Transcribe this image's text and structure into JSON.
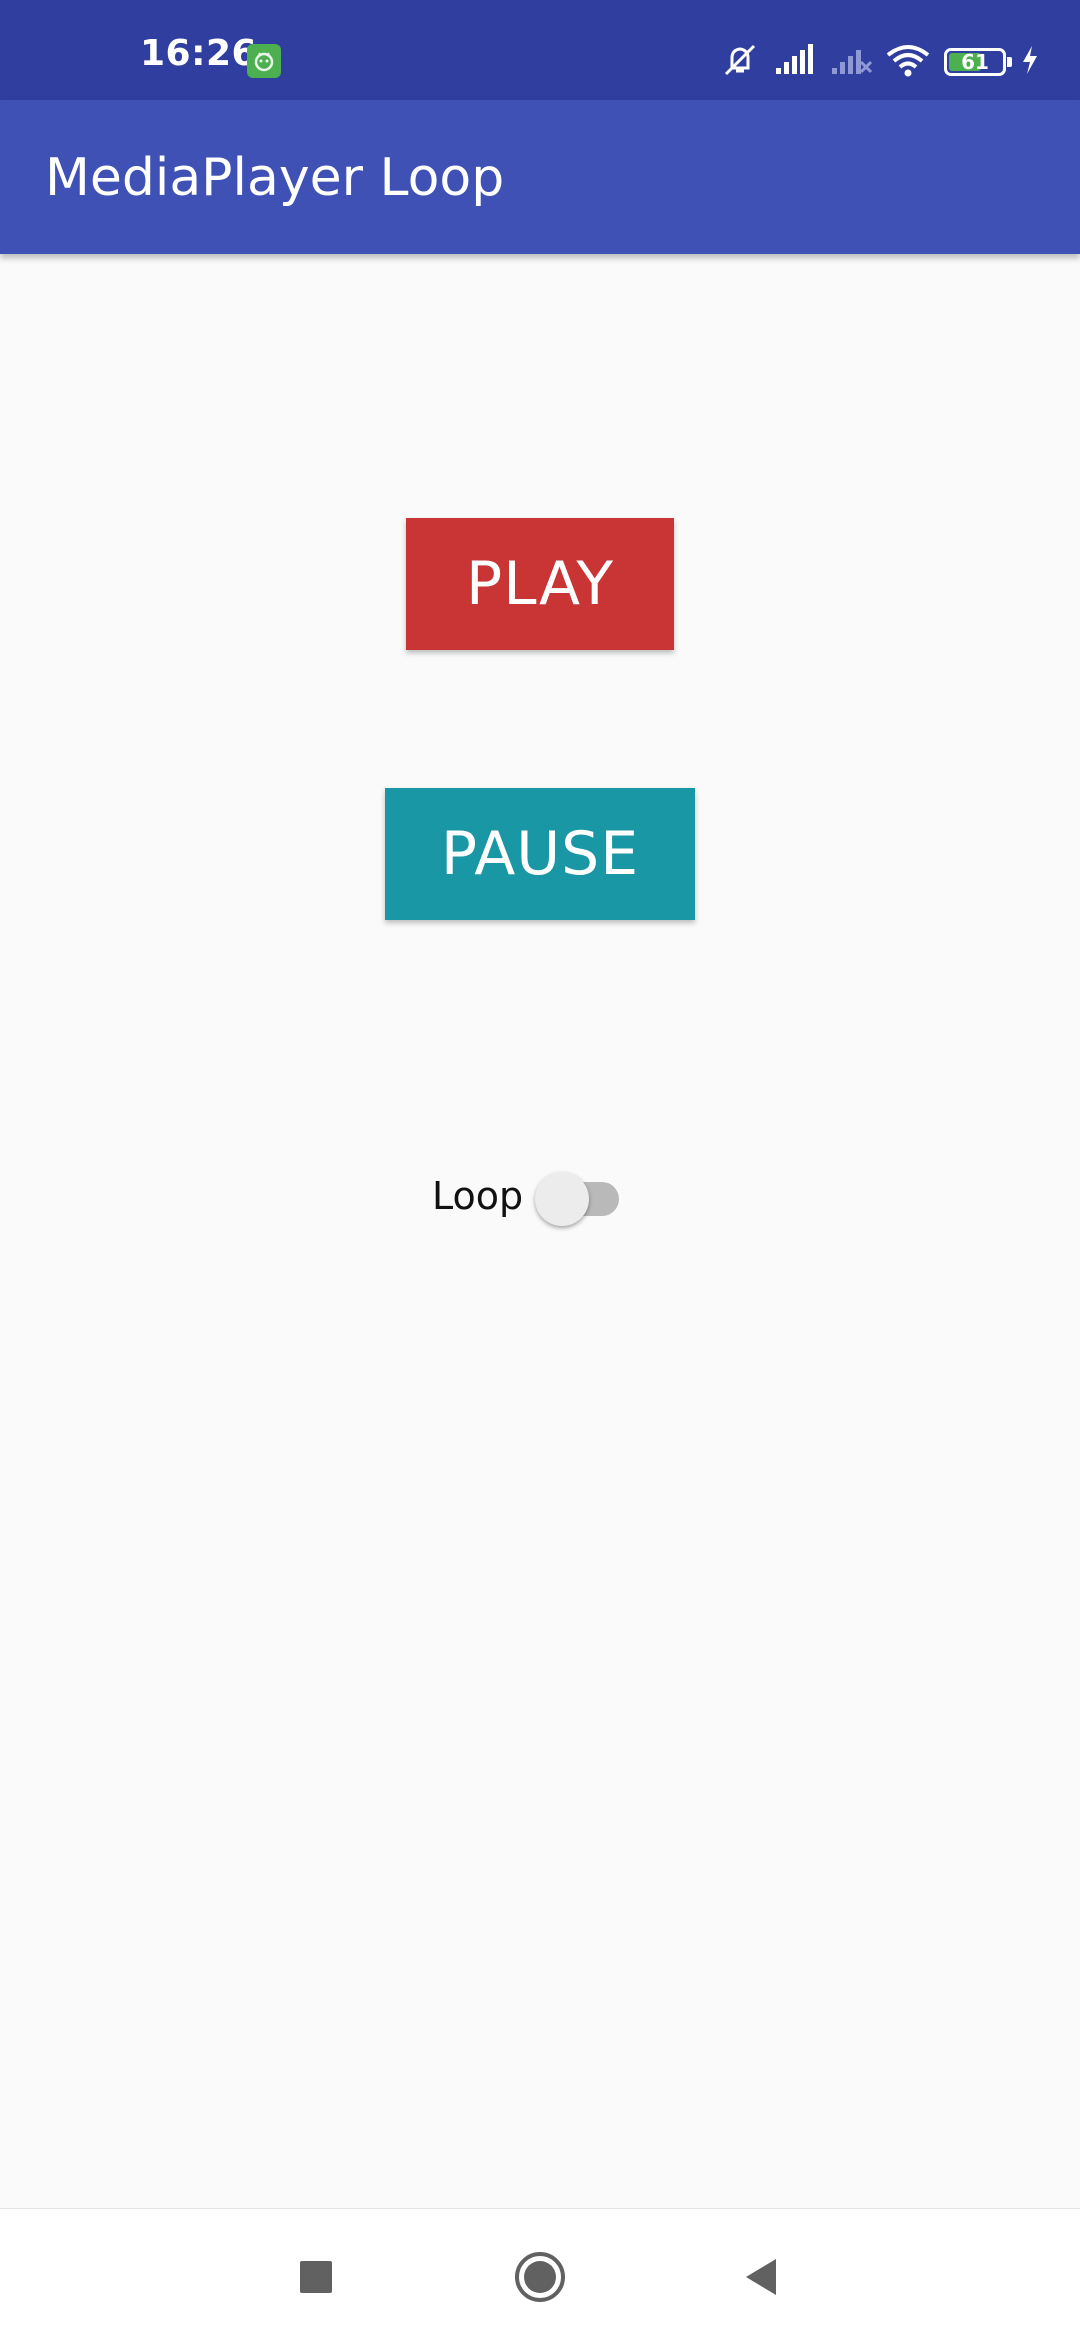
{
  "status_bar": {
    "time": "16:26",
    "battery_level": "61",
    "battery_fraction": 0.61,
    "icons": [
      "app-notification-icon",
      "mute-icon",
      "signal-icon",
      "no-signal-icon",
      "wifi-icon",
      "battery-icon",
      "charging-icon"
    ]
  },
  "app_bar": {
    "title": "MediaPlayer Loop"
  },
  "main": {
    "play_label": "PLAY",
    "pause_label": "PAUSE",
    "loop_label": "Loop",
    "loop_enabled": false
  },
  "nav_bar": {
    "icons": [
      "recent-apps-icon",
      "home-icon",
      "back-icon"
    ]
  },
  "colors": {
    "status_bar": "#303f9f",
    "app_bar": "#3f51b5",
    "play_button": "#c93434",
    "pause_button": "#1a97a5",
    "background": "#fafafa",
    "switch_track": "#b9b9b9",
    "switch_thumb": "#ececec"
  }
}
